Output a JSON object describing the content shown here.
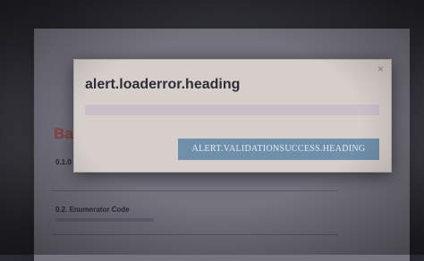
{
  "page": {
    "title_fragment": "Ba",
    "field_1_label": "0.1.0",
    "field_2_label": "0.2. Enumerator Code"
  },
  "modal": {
    "heading": "alert.loaderror.heading",
    "close_glyph": "×",
    "button_label": "ALERT.VALIDATIONSUCCESS.HEADING",
    "colors": {
      "background": "#d6ceca",
      "progress": "#cbbfc9",
      "button": "#6f8fab"
    }
  },
  "icons": {
    "close": "close-icon"
  }
}
